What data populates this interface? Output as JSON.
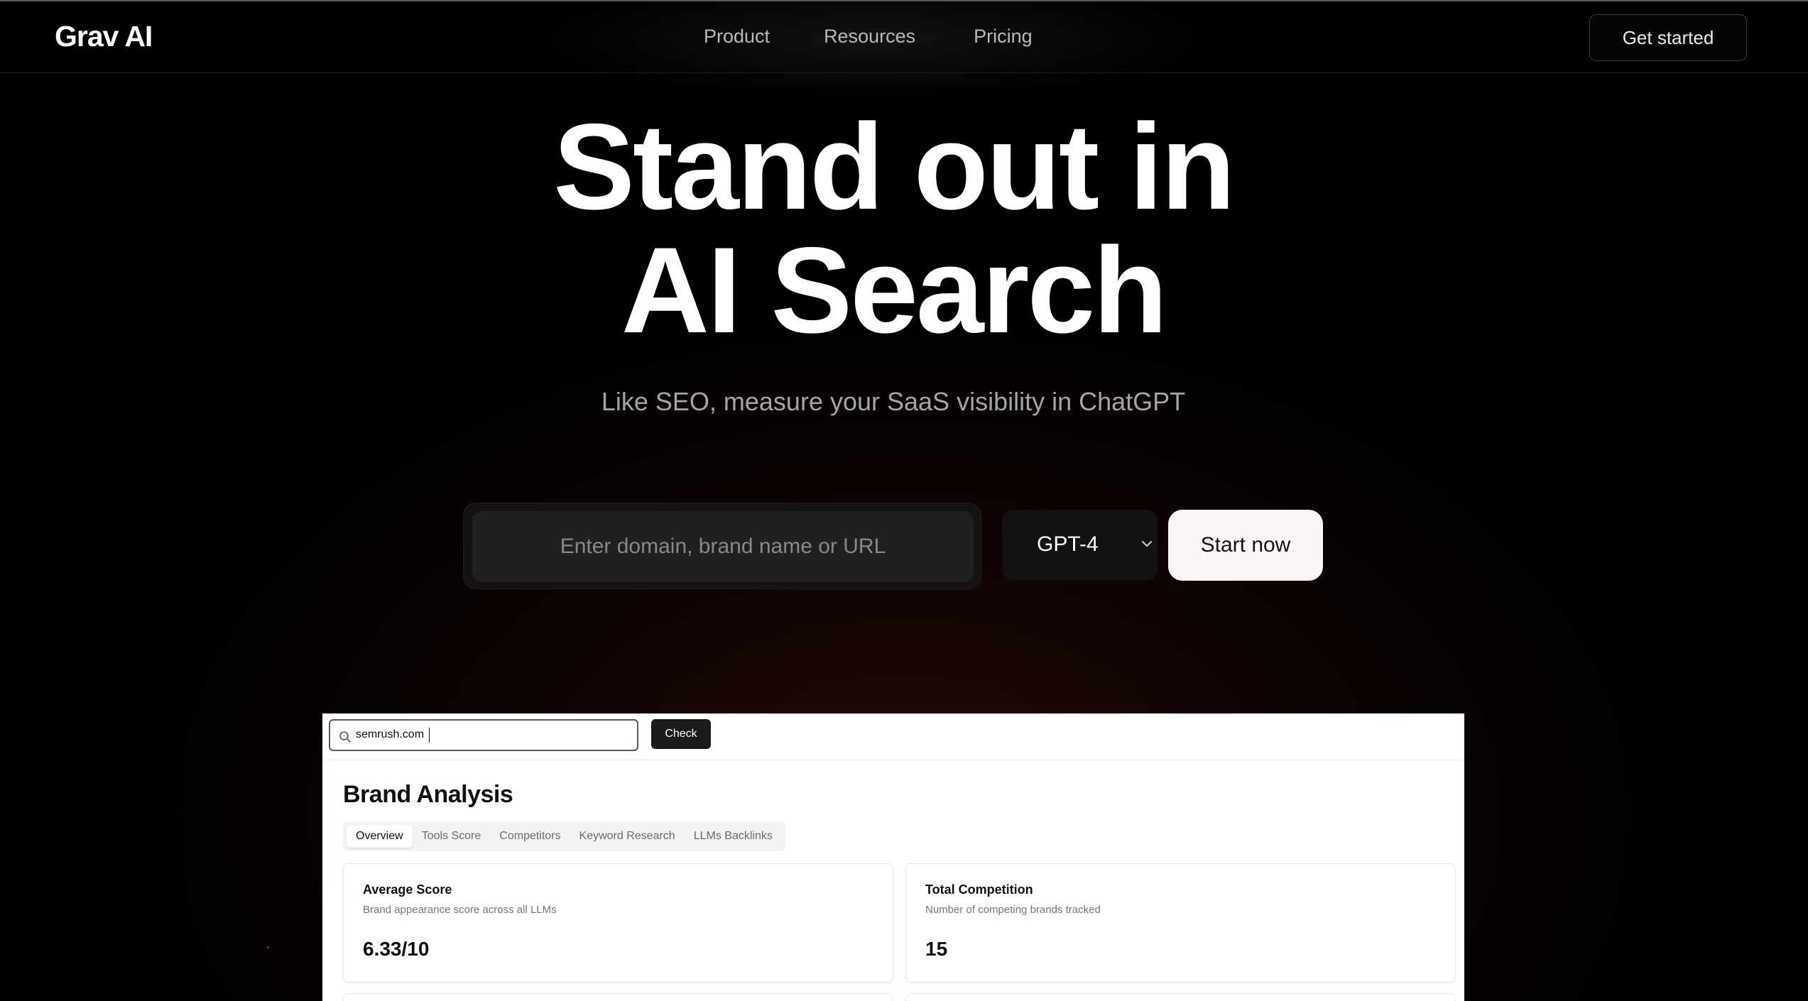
{
  "nav": {
    "logo": "Grav AI",
    "links": [
      "Product",
      "Resources",
      "Pricing"
    ],
    "cta": "Get started"
  },
  "hero": {
    "title_line1": "Stand out in",
    "title_line2": "AI Search",
    "subtitle": "Like SEO, measure your SaaS visibility in ChatGPT",
    "input_placeholder": "Enter domain, brand name or URL",
    "model_selected": "GPT-4",
    "start_button": "Start now"
  },
  "preview": {
    "search_value": "semrush.com",
    "check_button": "Check",
    "title": "Brand Analysis",
    "tabs": [
      "Overview",
      "Tools Score",
      "Competitors",
      "Keyword Research",
      "LLMs Backlinks"
    ],
    "active_tab": "Overview",
    "cards": [
      {
        "title": "Average Score",
        "description": "Brand appearance score across all LLMs",
        "value": "6.33/10"
      },
      {
        "title": "Total Competition",
        "description": "Number of competing brands tracked",
        "value": "15"
      }
    ]
  },
  "colors": {
    "background": "#000000",
    "accent_button": "#fbf6f5",
    "glow": "#46140c"
  }
}
